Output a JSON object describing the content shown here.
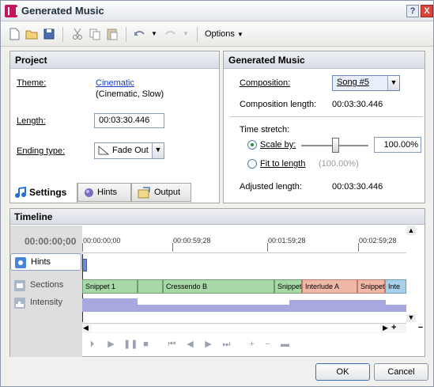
{
  "window": {
    "title": "Generated Music",
    "help_label": "?",
    "close_label": "X"
  },
  "toolbar": {
    "options_label": "Options"
  },
  "project": {
    "header": "Project",
    "theme_label": "Theme:",
    "theme_value": "Cinematic",
    "theme_detail": "(Cinematic, Slow)",
    "length_label": "Length:",
    "length_value": "00:03:30.446",
    "ending_label": "Ending type:",
    "ending_value": "Fade Out"
  },
  "tabs": [
    {
      "label": "Settings"
    },
    {
      "label": "Hints"
    },
    {
      "label": "Output"
    }
  ],
  "generated": {
    "header": "Generated Music",
    "composition_label": "Composition:",
    "composition_value": "Song #5",
    "comp_length_label": "Composition length:",
    "comp_length_value": "00:03:30.446",
    "stretch_label": "Time stretch:",
    "scale_label": "Scale by:",
    "scale_value": "100.00%",
    "scale_level": 0.5,
    "fit_label": "Fit to length",
    "fit_value": "(100.00%)",
    "adjusted_label": "Adjusted length:",
    "adjusted_value": "00:03:30.446"
  },
  "timeline": {
    "header": "Timeline",
    "current_time": "00:00:00;00",
    "tracks": [
      {
        "label": "Hints"
      },
      {
        "label": "Sections"
      },
      {
        "label": "Intensity"
      }
    ],
    "ruler_labels": [
      "00:00:00;00",
      "00:00:59;28",
      "00:01:59;28",
      "00:02:59;28"
    ],
    "segments": [
      {
        "label": "Snippet 1",
        "color": "#a8d8a8"
      },
      {
        "label": "",
        "color": "#a8d8a8"
      },
      {
        "label": "Cressendo B",
        "color": "#a8d8a8"
      },
      {
        "label": "Snippet",
        "color": "#a8d8a8"
      },
      {
        "label": "Interlude A",
        "color": "#f0b8a8"
      },
      {
        "label": "Snippet",
        "color": "#f0b8a8"
      },
      {
        "label": "Inte",
        "color": "#a8d0e8"
      }
    ],
    "zoom_in": "+",
    "zoom_out": "−"
  },
  "buttons": {
    "ok": "OK",
    "cancel": "Cancel"
  }
}
